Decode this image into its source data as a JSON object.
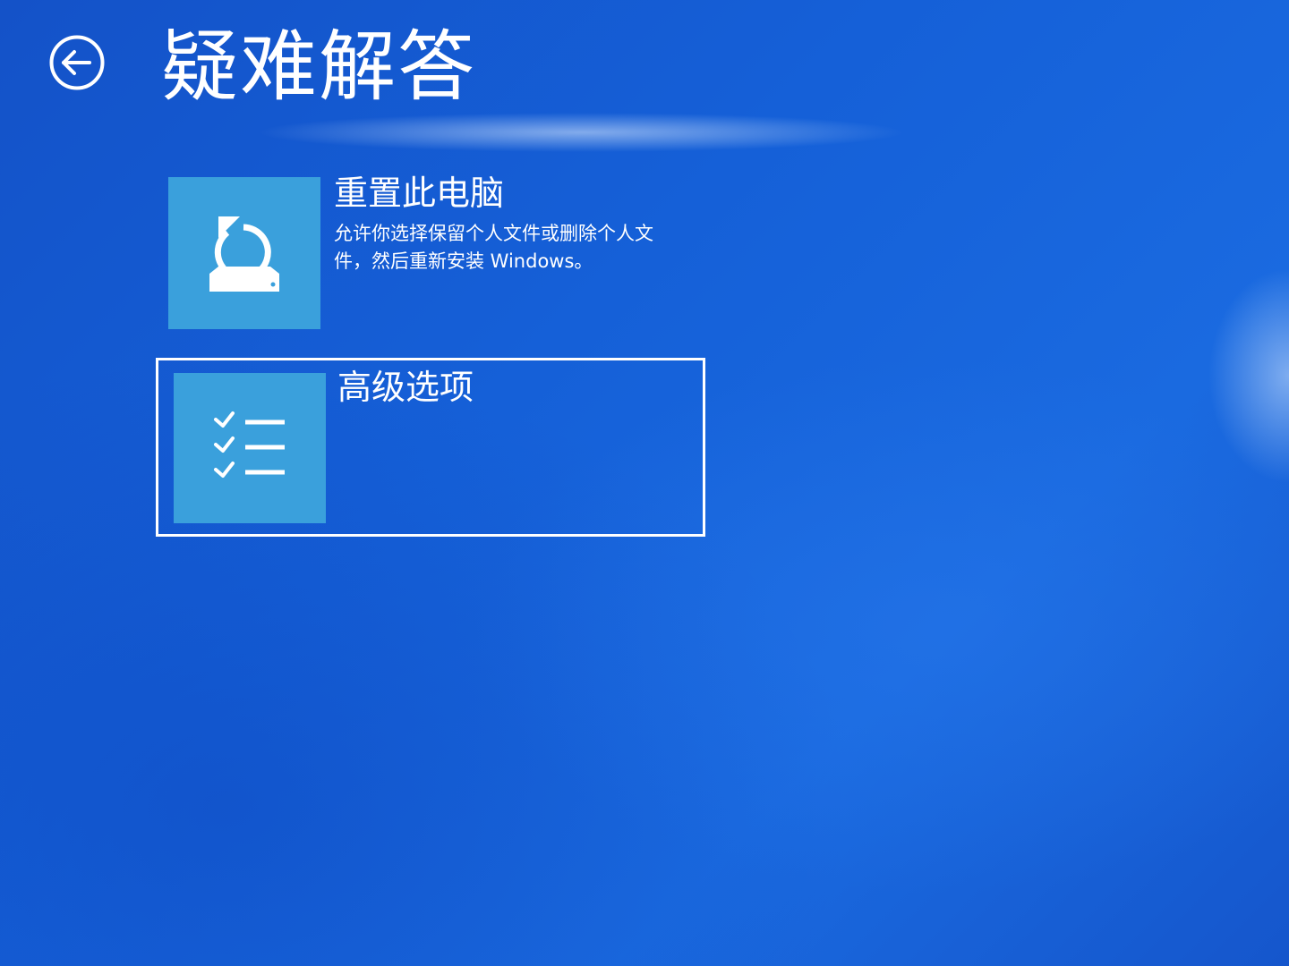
{
  "header": {
    "back_icon": "back-arrow-circle-icon",
    "title": "疑难解答"
  },
  "options": [
    {
      "icon": "reset-pc-icon",
      "title": "重置此电脑",
      "description": "允许你选择保留个人文件或删除个人文件，然后重新安装 Windows。"
    },
    {
      "icon": "checklist-icon",
      "title": "高级选项",
      "selected": true
    }
  ],
  "colors": {
    "background": "#1560d8",
    "tile": "#3aa0dc",
    "text": "#ffffff",
    "selection_border": "#ffffff"
  }
}
